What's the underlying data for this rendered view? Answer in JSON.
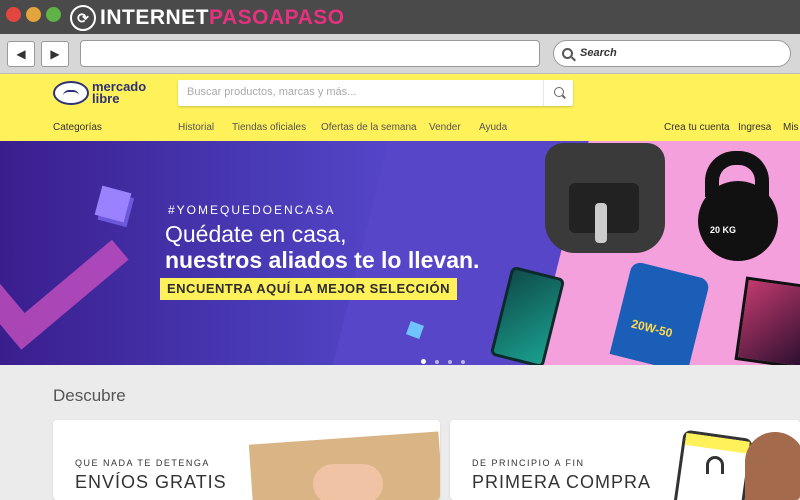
{
  "browser": {
    "site_brand_a": "INTERNET",
    "site_brand_b": "PASOAPASO",
    "back_label": "◀",
    "forward_label": "▶",
    "search_placeholder": "Search"
  },
  "header": {
    "logo_text": "mercado libre",
    "search_placeholder": "Buscar productos, marcas y más...",
    "nav_left": "Categorías",
    "nav_items": [
      "Historial",
      "Tiendas oficiales",
      "Ofertas de la semana",
      "Vender",
      "Ayuda"
    ],
    "account": {
      "create": "Crea tu cuenta",
      "login": "Ingresa",
      "more": "Mis"
    }
  },
  "banner": {
    "hashtag": "#YOMEQUEDOENCASA",
    "line1": "Quédate en casa,",
    "line2": "nuestros aliados te lo llevan.",
    "cta": "ENCUENTRA AQUÍ LA MEJOR SELECCIÓN",
    "kettle_label": "20 KG",
    "oil_label": "20W-50",
    "slides": 4,
    "active_slide": 1
  },
  "discover": {
    "title": "Descubre",
    "cards": [
      {
        "overline": "QUE NADA TE DETENGA",
        "title": "ENVÍOS GRATIS"
      },
      {
        "overline": "DE PRINCIPIO A FIN",
        "title": "PRIMERA COMPRA"
      }
    ]
  },
  "colors": {
    "ml_yellow": "#fff159",
    "banner_purple": "#4a3cb8",
    "banner_pink": "#f4a0dc"
  }
}
